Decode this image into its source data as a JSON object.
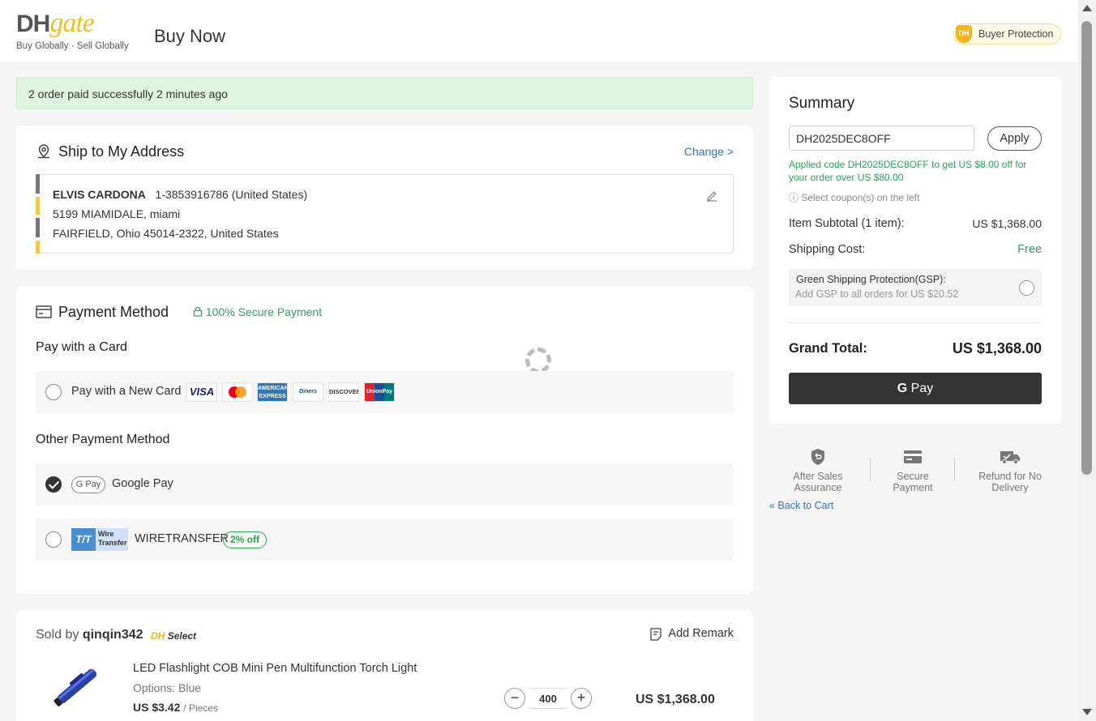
{
  "header": {
    "logo_text_dh": "DH",
    "logo_text_gate": "gate",
    "logo_tagline": "Buy Globally · Sell Globally",
    "page_title": "Buy Now",
    "buyer_protection": "Buyer Protection",
    "buyer_protection_badge": "DH"
  },
  "success_banner": "2 order paid successfully 2 minutes ago",
  "ship": {
    "title": "Ship to My Address",
    "change_link": "Change >",
    "name": "ELVIS CARDONA",
    "phone": "1-3853916786 (United States)",
    "line1": "5199 MIAMIDALE, miami",
    "line2": "FAIRFIELD, Ohio 45014-2322, United States"
  },
  "payment": {
    "title": "Payment Method",
    "secure": "100% Secure Payment",
    "pay_with_card_heading": "Pay with a Card",
    "new_card_label": "Pay with a New Card",
    "card_brands": [
      "VISA",
      "MasterCard",
      "AMERICAN EXPRESS",
      "Diners Club",
      "DISCOVER",
      "UnionPay"
    ],
    "other_heading": "Other Payment Method",
    "google_pay_badge": "G Pay",
    "google_pay_label": "Google Pay",
    "wire_badge_tt": "T/T",
    "wire_badge_text": "Wire Transfer",
    "wire_label": "WIRETRANSFER",
    "wire_discount": "2% off",
    "selected_method": "Google Pay"
  },
  "seller": {
    "sold_by_prefix": "Sold by",
    "seller_name": "qinqin342",
    "badge_dh": "DH",
    "badge_select": "Select",
    "add_remark": "Add Remark",
    "product": {
      "name": "LED Flashlight COB Mini Pen Multifunction Torch Light",
      "options": "Options: Blue",
      "unit_price": "US $3.42",
      "unit": "/ Pieces",
      "quantity": "400",
      "total": "US $1,368.00"
    }
  },
  "summary": {
    "title": "Summary",
    "coupon_value": "DH2025DEC8OFF",
    "apply_label": "Apply",
    "applied_message": "Applied code DH2025DEC8OFF to get US $8.00 off for your order over US $80.00",
    "select_coupon_hint": "ⓘ Select coupon(s) on the left",
    "subtotal_label": "Item Subtotal (1 item):",
    "subtotal_value": "US $1,368.00",
    "shipping_label": "Shipping Cost:",
    "shipping_value": "Free",
    "gsp_title": "Green Shipping Protection(GSP):",
    "gsp_subtitle": "Add GSP to all orders for US $20.52",
    "grand_total_label": "Grand Total:",
    "grand_total_value": "US $1,368.00",
    "pay_button_g": "G",
    "pay_button_text": "Pay"
  },
  "assurance": [
    {
      "line1": "After Sales",
      "line2": "Assurance",
      "icon": "shield-return-icon"
    },
    {
      "line1": "Secure",
      "line2": "Payment",
      "icon": "credit-card-icon"
    },
    {
      "line1": "Refund for No",
      "line2": "Delivery",
      "icon": "truck-check-icon"
    }
  ],
  "back_to_cart": "« Back to Cart",
  "colors": {
    "accent_green": "#2aa558",
    "link_blue": "#2a74c6",
    "brand_yellow": "#f2c01e",
    "success_bg": "#dff4de",
    "pay_button": "#333333"
  }
}
